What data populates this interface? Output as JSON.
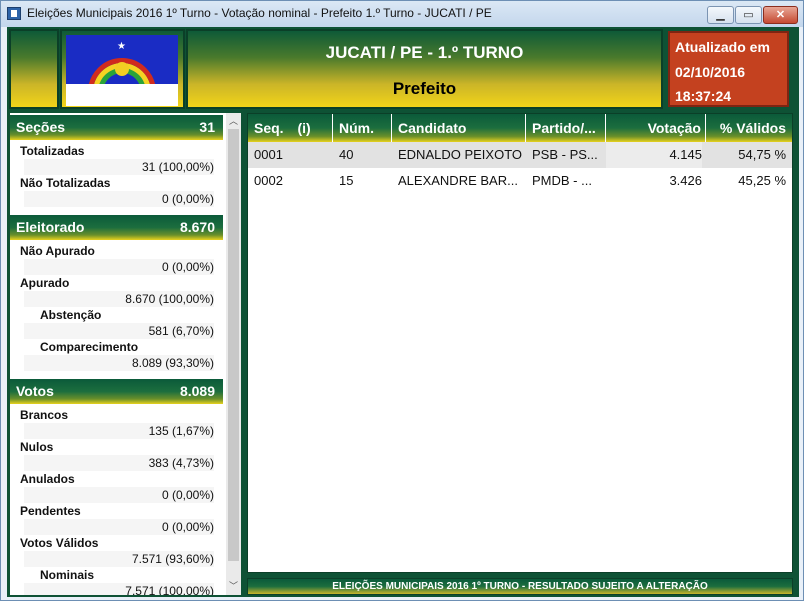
{
  "window": {
    "title": "Eleições Municipais 2016 1º Turno - Votação nominal - Prefeito 1.º Turno - JUCATI / PE",
    "min": "▁",
    "max": "▭",
    "close": "✕"
  },
  "header": {
    "city": "JUCATI / PE - 1.º TURNO",
    "office": "Prefeito",
    "updated_label": "Atualizado em",
    "updated_date": "02/10/2016",
    "updated_time": "18:37:24"
  },
  "flag": {
    "star": "★",
    "cross": "✝"
  },
  "secoes": {
    "label": "Seções",
    "value": "31",
    "totalizadas_label": "Totalizadas",
    "totalizadas_value": "31 (100,00%)",
    "nao_totalizadas_label": "Não Totalizadas",
    "nao_totalizadas_value": "0 (0,00%)"
  },
  "eleitorado": {
    "label": "Eleitorado",
    "value": "8.670",
    "nao_apurado_label": "Não Apurado",
    "nao_apurado_value": "0 (0,00%)",
    "apurado_label": "Apurado",
    "apurado_value": "8.670 (100,00%)",
    "abstencao_label": "Abstenção",
    "abstencao_value": "581 (6,70%)",
    "comparecimento_label": "Comparecimento",
    "comparecimento_value": "8.089 (93,30%)"
  },
  "votos": {
    "label": "Votos",
    "value": "8.089",
    "brancos_label": "Brancos",
    "brancos_value": "135 (1,67%)",
    "nulos_label": "Nulos",
    "nulos_value": "383 (4,73%)",
    "anulados_label": "Anulados",
    "anulados_value": "0 (0,00%)",
    "pendentes_label": "Pendentes",
    "pendentes_value": "0 (0,00%)",
    "validos_label": "Votos Válidos",
    "validos_value": "7.571 (93,60%)",
    "nominais_label": "Nominais",
    "nominais_value": "7.571 (100,00%)"
  },
  "scroll": {
    "up": "︿",
    "down": "﹀"
  },
  "table": {
    "headers": {
      "seq": "Seq.",
      "seq_i": "(i)",
      "num": "Núm.",
      "candidato": "Candidato",
      "partido": "Partido/...",
      "votacao": "Votação",
      "validos": "% Válidos"
    },
    "rows": [
      {
        "seq": "0001",
        "num": "40",
        "candidato": "EDNALDO PEIXOTO",
        "partido": "PSB - PS...",
        "votacao": "4.145",
        "validos": "54,75 %"
      },
      {
        "seq": "0002",
        "num": "15",
        "candidato": "ALEXANDRE BAR...",
        "partido": "PMDB - ...",
        "votacao": "3.426",
        "validos": "45,25 %"
      }
    ]
  },
  "footer": {
    "text": "ELEIÇÕES MUNICIPAIS 2016 1º TURNO - RESULTADO SUJEITO A ALTERAÇÃO"
  },
  "colors": {
    "header_green": "#0e5235",
    "header_yellow": "#f2d419",
    "update_red": "#c4411f"
  }
}
